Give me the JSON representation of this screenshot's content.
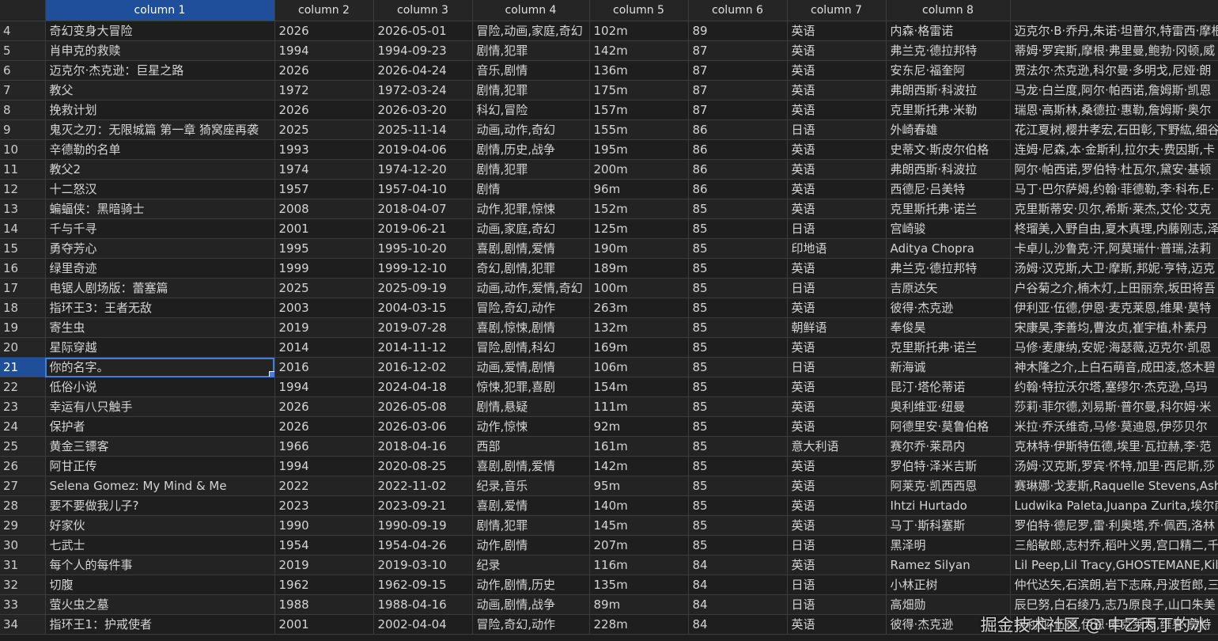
{
  "grid": {
    "headers": [
      "",
      "column 1",
      "column 2",
      "column 3",
      "column 4",
      "column 5",
      "column 6",
      "column 7",
      "column 8",
      ""
    ],
    "selected_column": 1,
    "selected_row": "21",
    "rows": [
      [
        "4",
        "奇幻变身大冒险",
        "2026",
        "2026-05-01",
        "冒险,动画,家庭,奇幻",
        "102m",
        "89",
        "英语",
        "内森·格雷诺",
        "迈克尔·B·乔丹,朱诺·坦普尔,特雷西·摩根"
      ],
      [
        "5",
        "肖申克的救赎",
        "1994",
        "1994-09-23",
        "剧情,犯罪",
        "142m",
        "87",
        "英语",
        "弗兰克·德拉邦特",
        "蒂姆·罗宾斯,摩根·弗里曼,鲍勃·冈顿,威"
      ],
      [
        "6",
        "迈克尔·杰克逊：巨星之路",
        "2026",
        "2026-04-24",
        "音乐,剧情",
        "136m",
        "87",
        "英语",
        "安东尼·福奎阿",
        "贾法尔·杰克逊,科尔曼·多明戈,尼娅·朗"
      ],
      [
        "7",
        "教父",
        "1972",
        "1972-03-24",
        "剧情,犯罪",
        "175m",
        "87",
        "英语",
        "弗朗西斯·科波拉",
        "马龙·白兰度,阿尔·帕西诺,詹姆斯·凯恩"
      ],
      [
        "8",
        "挽救计划",
        "2026",
        "2026-03-20",
        "科幻,冒险",
        "157m",
        "87",
        "英语",
        "克里斯托弗·米勒",
        "瑞恩·高斯林,桑德拉·惠勒,詹姆斯·奥尔"
      ],
      [
        "9",
        "鬼灭之刃：无限城篇 第一章 猗窝座再袭",
        "2025",
        "2025-11-14",
        "动画,动作,奇幻",
        "155m",
        "86",
        "日语",
        "外崎春雄",
        "花江夏树,樱井孝宏,石田彰,下野紘,细谷"
      ],
      [
        "10",
        "辛德勒的名单",
        "1993",
        "2019-04-06",
        "剧情,历史,战争",
        "195m",
        "86",
        "英语",
        "史蒂文·斯皮尔伯格",
        "连姆·尼森,本·金斯利,拉尔夫·费因斯,卡"
      ],
      [
        "11",
        "教父2",
        "1974",
        "1974-12-20",
        "剧情,犯罪",
        "200m",
        "86",
        "英语",
        "弗朗西斯·科波拉",
        "阿尔·帕西诺,罗伯特·杜瓦尔,黛安·基顿"
      ],
      [
        "12",
        "十二怒汉",
        "1957",
        "1957-04-10",
        "剧情",
        "96m",
        "86",
        "英语",
        "西德尼·吕美特",
        "马丁·巴尔萨姆,约翰·菲德勒,李·科布,E·"
      ],
      [
        "13",
        "蝙蝠侠：黑暗骑士",
        "2008",
        "2018-04-07",
        "动作,犯罪,惊悚",
        "152m",
        "85",
        "英语",
        "克里斯托弗·诺兰",
        "克里斯蒂安·贝尔,希斯·莱杰,艾伦·艾克"
      ],
      [
        "14",
        "千与千寻",
        "2001",
        "2019-06-21",
        "动画,家庭,奇幻",
        "125m",
        "85",
        "日语",
        "宫崎骏",
        "柊瑠美,入野自由,夏木真理,内藤刚志,泽"
      ],
      [
        "15",
        "勇夺芳心",
        "1995",
        "1995-10-20",
        "喜剧,剧情,爱情",
        "190m",
        "85",
        "印地语",
        "Aditya Chopra",
        "卡卓儿,沙鲁克·汗,阿莫瑞什·普瑞,法莉"
      ],
      [
        "16",
        "绿里奇迹",
        "1999",
        "1999-12-10",
        "奇幻,剧情,犯罪",
        "189m",
        "85",
        "英语",
        "弗兰克·德拉邦特",
        "汤姆·汉克斯,大卫·摩斯,邦妮·亨特,迈克"
      ],
      [
        "17",
        "电锯人剧场版：蕾塞篇",
        "2025",
        "2025-09-19",
        "动画,动作,爱情,奇幻",
        "100m",
        "85",
        "日语",
        "吉原达矢",
        "户谷菊之介,楠木灯,上田丽奈,坂田将吾"
      ],
      [
        "18",
        "指环王3：王者无敌",
        "2003",
        "2004-03-15",
        "冒险,奇幻,动作",
        "263m",
        "85",
        "英语",
        "彼得·杰克逊",
        "伊利亚·伍德,伊恩·麦克莱恩,维果·莫特"
      ],
      [
        "19",
        "寄生虫",
        "2019",
        "2019-07-28",
        "喜剧,惊悚,剧情",
        "132m",
        "85",
        "朝鲜语",
        "奉俊昊",
        "宋康昊,李善均,曹汝贞,崔宇植,朴素丹"
      ],
      [
        "20",
        "星际穿越",
        "2014",
        "2014-11-12",
        "冒险,剧情,科幻",
        "169m",
        "85",
        "英语",
        "克里斯托弗·诺兰",
        "马修·麦康纳,安妮·海瑟薇,迈克尔·凯恩"
      ],
      [
        "21",
        "你的名字。",
        "2016",
        "2016-12-02",
        "动画,爱情,剧情",
        "106m",
        "85",
        "日语",
        "新海诚",
        "神木隆之介,上白石萌音,成田凌,悠木碧"
      ],
      [
        "22",
        "低俗小说",
        "1994",
        "2024-04-18",
        "惊悚,犯罪,喜剧",
        "154m",
        "85",
        "英语",
        "昆汀·塔伦蒂诺",
        "约翰·特拉沃尔塔,塞缪尔·杰克逊,乌玛"
      ],
      [
        "23",
        "幸运有八只触手",
        "2026",
        "2026-05-08",
        "剧情,悬疑",
        "111m",
        "85",
        "英语",
        "奥利维亚·纽曼",
        "莎莉·菲尔德,刘易斯·普尔曼,科尔姆·米"
      ],
      [
        "24",
        "保护者",
        "2026",
        "2026-03-06",
        "动作,惊悚",
        "92m",
        "85",
        "英语",
        "阿德里安·莫鲁伯格",
        "米拉·乔沃维奇,马修·莫迪恩,伊莎贝尔"
      ],
      [
        "25",
        "黄金三镖客",
        "1966",
        "2018-04-16",
        "西部",
        "161m",
        "85",
        "意大利语",
        "赛尔乔·莱昂内",
        "克林特·伊斯特伍德,埃里·瓦拉赫,李·范"
      ],
      [
        "26",
        "阿甘正传",
        "1994",
        "2020-08-25",
        "喜剧,剧情,爱情",
        "142m",
        "85",
        "英语",
        "罗伯特·泽米吉斯",
        "汤姆·汉克斯,罗宾·怀特,加里·西尼斯,莎"
      ],
      [
        "27",
        "Selena Gomez: My Mind & Me",
        "2022",
        "2022-11-02",
        "纪录,音乐",
        "95m",
        "85",
        "英语",
        "阿莱克·凯西西恩",
        "赛琳娜·戈麦斯,Raquelle Stevens,Ashley"
      ],
      [
        "28",
        "要不要做我儿子?",
        "2023",
        "2023-09-21",
        "喜剧,爱情",
        "140m",
        "85",
        "英语",
        "Ihtzi Hurtado",
        "Ludwika Paleta,Juanpa Zurita,埃尔南"
      ],
      [
        "29",
        "好家伙",
        "1990",
        "1990-09-19",
        "剧情,犯罪",
        "145m",
        "85",
        "英语",
        "马丁·斯科塞斯",
        "罗伯特·德尼罗,雷·利奥塔,乔·佩西,洛林"
      ],
      [
        "30",
        "七武士",
        "1954",
        "1954-04-26",
        "动作,剧情",
        "207m",
        "85",
        "日语",
        "黑泽明",
        "三船敏郎,志村乔,稻叶义男,宫口精二,千"
      ],
      [
        "31",
        "每个人的每件事",
        "2019",
        "2019-03-10",
        "纪录",
        "116m",
        "84",
        "英语",
        "Ramez Silyan",
        "Lil Peep,Lil Tracy,GHOSTEMANE,Killstation"
      ],
      [
        "32",
        "切腹",
        "1962",
        "1962-09-15",
        "动作,剧情,历史",
        "135m",
        "84",
        "日语",
        "小林正树",
        "仲代达矢,石滨朗,岩下志麻,丹波哲郎,三"
      ],
      [
        "33",
        "萤火虫之墓",
        "1988",
        "1988-04-16",
        "动画,剧情,战争",
        "89m",
        "84",
        "日语",
        "高畑勋",
        "辰巳努,白石绫乃,志乃原良子,山口朱美"
      ],
      [
        "34",
        "指环王1：护戒使者",
        "2001",
        "2002-04-04",
        "冒险,奇幻,动作",
        "228m",
        "84",
        "英语",
        "彼得·杰克逊",
        "伊利亚·伍德,伊恩·麦克莱恩,维果·莫特"
      ]
    ]
  },
  "watermark": "掘金技术社区 @ 中乙丙丁的冰"
}
